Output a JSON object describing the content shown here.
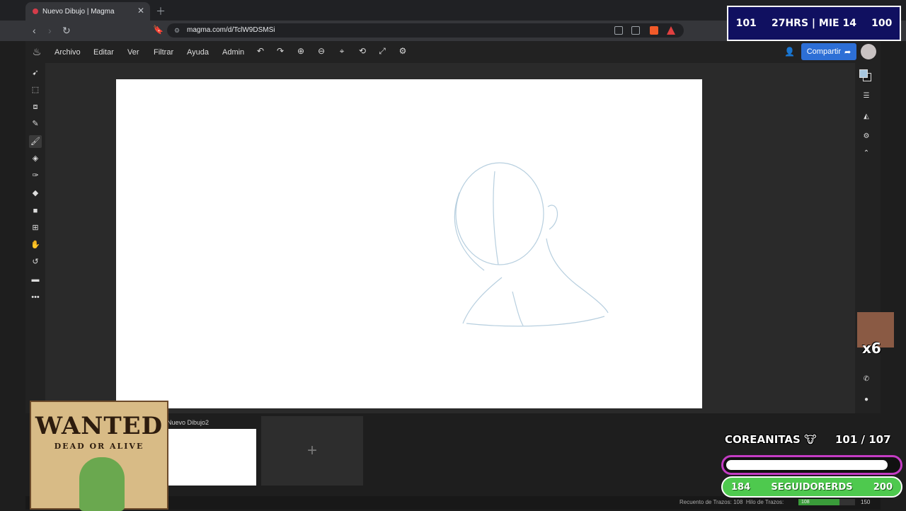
{
  "browser": {
    "tab_title": "Nuevo Dibujo | Magma",
    "url": "magma.com/d/TclW9DSMSi"
  },
  "app_menu": {
    "items": [
      "Archivo",
      "Editar",
      "Ver",
      "Filtrar",
      "Ayuda",
      "Admin"
    ],
    "share_label": "Compartir"
  },
  "documents": {
    "current_label": "Nuevo Dibujo2",
    "new_doc_symbol": "+"
  },
  "status": {
    "stroke_count_label": "Recuento de Trazos:",
    "stroke_count": "108",
    "thread_label": "Hilo de Trazos:",
    "thread_value": "108",
    "thread_max": "150",
    "thread_fraction": 0.72
  },
  "overlay": {
    "top_left": "101",
    "top_center": "27HRS | MIE 14",
    "top_right": "100",
    "emote_count": "x6",
    "goal_label": "COREANITAS 🐮",
    "goal_count": "101  / 107",
    "goal_fraction": 0.944,
    "followers_left": "184",
    "followers_label": "SEGUIDORERDS",
    "followers_right": "200",
    "wanted_title": "WANTED",
    "wanted_sub": "DEAD OR ALIVE"
  },
  "colors": {
    "accent": "#2d6fd6",
    "primary_color": "#a7c6de",
    "secondary_color": "#1a1a1a"
  }
}
